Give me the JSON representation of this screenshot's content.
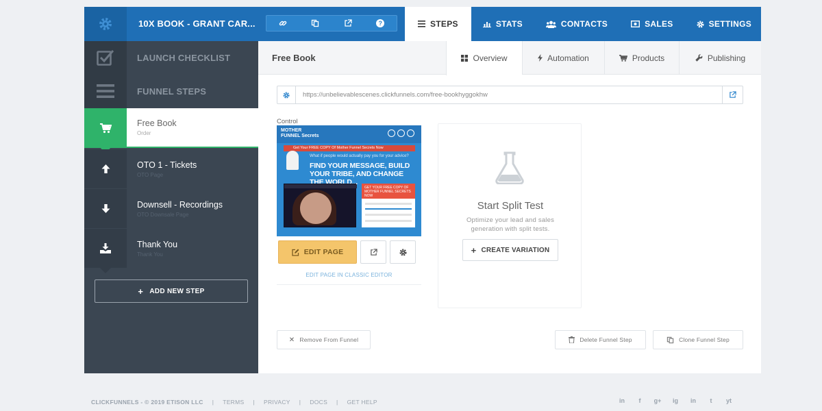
{
  "header": {
    "funnel_title": "10X BOOK - GRANT CAR...",
    "tabs": [
      {
        "label": "STEPS",
        "icon": "list-icon"
      },
      {
        "label": "STATS",
        "icon": "bar-chart-icon"
      },
      {
        "label": "CONTACTS",
        "icon": "users-icon"
      },
      {
        "label": "SALES",
        "icon": "money-icon"
      },
      {
        "label": "SETTINGS",
        "icon": "gear-icon"
      }
    ],
    "icon_buttons": [
      "link-icon",
      "copy-icon",
      "external-link-icon",
      "help-icon"
    ],
    "help_glyph": "?"
  },
  "sidebar": {
    "launch_checklist": "LAUNCH CHECKLIST",
    "funnel_steps": "FUNNEL STEPS",
    "steps": [
      {
        "name": "Free Book",
        "type": "Order",
        "icon": "cart-icon"
      },
      {
        "name": "OTO 1 - Tickets",
        "type": "OTO Page",
        "icon": "arrow-up-icon"
      },
      {
        "name": "Downsell - Recordings",
        "type": "OTO Downsale Page",
        "icon": "arrow-down-icon"
      },
      {
        "name": "Thank You",
        "type": "Thank You",
        "icon": "download-icon"
      }
    ],
    "add_step_label": "ADD NEW STEP"
  },
  "content": {
    "page_title": "Free Book",
    "subtabs": [
      {
        "label": "Overview",
        "icon": "grid-icon"
      },
      {
        "label": "Automation",
        "icon": "bolt-icon"
      },
      {
        "label": "Products",
        "icon": "cart-icon"
      },
      {
        "label": "Publishing",
        "icon": "wrench-icon"
      }
    ],
    "url": "https://unbelievablescenes.clickfunnels.com/free-bookhyggokhw",
    "control_label": "Control",
    "thumbnail": {
      "logo": "MOTHER FUNNEL Secrets",
      "banner": "Get Your FREE COPY Of Mother Funnel Secrets Now",
      "small": "What if people would actually pay you for your advice?",
      "headline": "FIND YOUR MESSAGE, BUILD YOUR TRIBE, AND CHANGE THE WORLD...",
      "form_header": "GET YOUR FREE COPY OF MOTHER FUNNEL SECRETS NOW"
    },
    "edit_page_label": "EDIT PAGE",
    "classic_editor_label": "EDIT PAGE IN CLASSIC EDITOR",
    "split_test": {
      "title": "Start Split Test",
      "description": "Optimize your lead and sales generation with split tests.",
      "create_label": "CREATE VARIATION"
    },
    "remove_label": "Remove From Funnel",
    "delete_label": "Delete Funnel Step",
    "clone_label": "Clone Funnel Step"
  },
  "footer": {
    "brand": "CLICKFUNNELS - © 2019 ETISON LLC",
    "links": [
      "TERMS",
      "PRIVACY",
      "DOCS",
      "GET HELP"
    ],
    "social_glyphs": [
      "in",
      "f",
      "g+",
      "ig",
      "in",
      "t",
      "yt"
    ],
    "social": [
      "linkedin-box-icon",
      "facebook-icon",
      "google-plus-icon",
      "instagram-icon",
      "linkedin-icon",
      "twitter-icon",
      "youtube-icon"
    ]
  },
  "colors": {
    "brand_blue": "#1f6fb6",
    "sidebar": "#3b4652",
    "active_green": "#2fb36a",
    "edit_button": "#f4c56b"
  }
}
